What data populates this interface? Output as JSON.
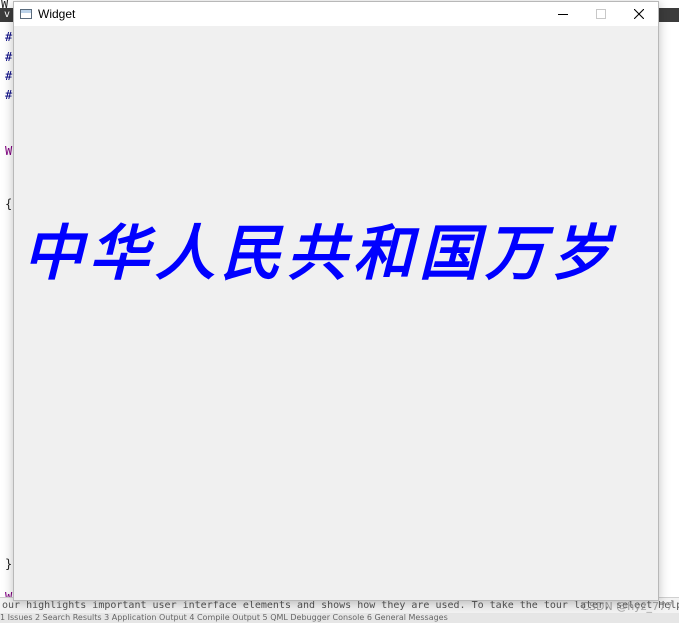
{
  "window": {
    "title": "Widget",
    "slogan": "中华人民共和国万岁",
    "slogan_color": "#0000ff",
    "controls": {
      "minimize_icon": "minimize-icon",
      "maximize_icon": "maximize-icon",
      "close_icon": "close-icon"
    }
  },
  "background_editor": {
    "top_fragment": "W",
    "dark_fragment": "v",
    "lines": [
      "#",
      "#",
      "#",
      "#",
      "W",
      "{",
      "}",
      "W"
    ],
    "status_text": "our highlights important user interface elements and shows how they are used. To take the tour later, select Help > UI Tour.",
    "bottom_text": "1 Issues  2 Search Results  3 Application Output  4 Compile Output  5 QML Debugger Console  6 General Messages",
    "watermark": "CSDN @hyz_777"
  },
  "colors": {
    "window_bg": "#f0f0f0",
    "titlebar_bg": "#ffffff",
    "slogan_blue": "#0000ff"
  }
}
